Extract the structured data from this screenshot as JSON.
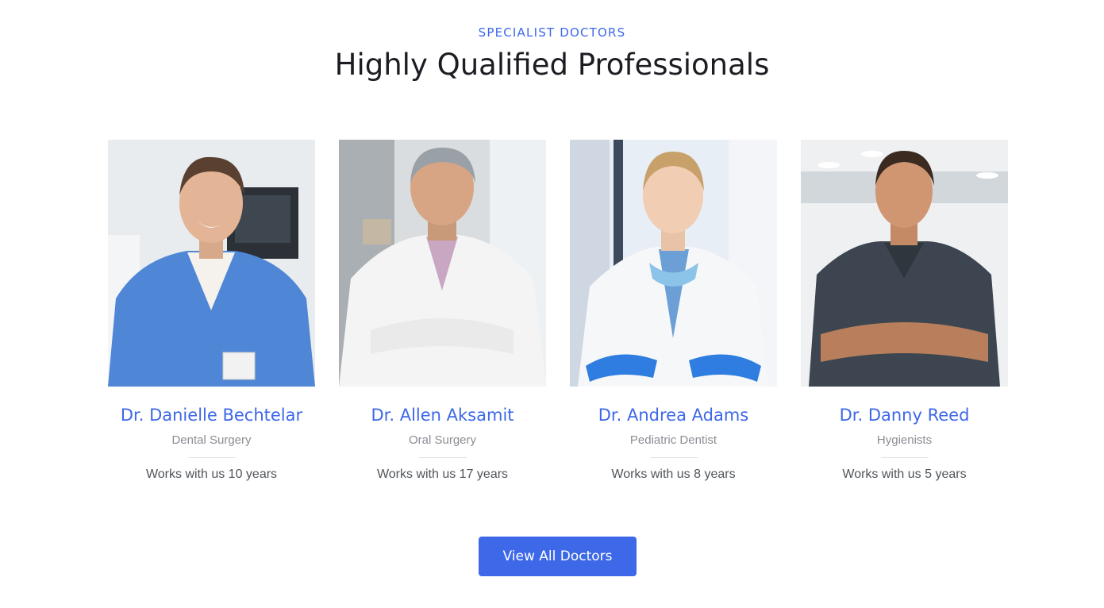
{
  "header": {
    "eyebrow": "SPECIALIST DOCTORS",
    "title": "Highly Qualified Professionals"
  },
  "doctors": [
    {
      "name": "Dr. Danielle Bechtelar",
      "specialty": "Dental Surgery",
      "tenure": "Works with us 10 years"
    },
    {
      "name": "Dr. Allen Aksamit",
      "specialty": "Oral Surgery",
      "tenure": "Works with us 17 years"
    },
    {
      "name": "Dr. Andrea Adams",
      "specialty": "Pediatric Dentist",
      "tenure": "Works with us 8 years"
    },
    {
      "name": "Dr. Danny Reed",
      "specialty": "Hygienists",
      "tenure": "Works with us 5 years"
    }
  ],
  "cta": {
    "label": "View All Doctors"
  },
  "colors": {
    "accent": "#3d68e8",
    "heading": "#1c1d22",
    "muted": "#8a8d93"
  }
}
